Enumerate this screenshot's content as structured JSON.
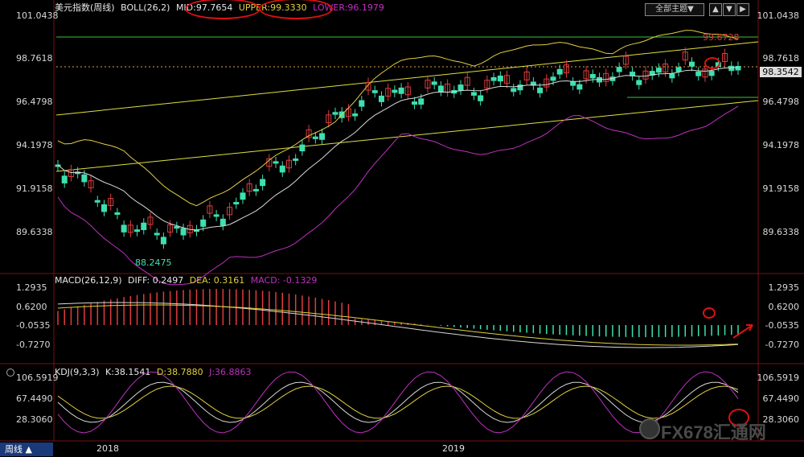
{
  "header": {
    "symbol": "美元指数(周线)",
    "boll_label": "BOLL(26,2)",
    "mid": "MID:97.7654",
    "upper": "UPPER:99.3330",
    "lower": "LOWER:96.1979"
  },
  "toolbar": {
    "dropdown_label": "全部主题▼"
  },
  "price_axis": {
    "left": [
      "101.0438",
      "98.7618",
      "96.4798",
      "94.1978",
      "91.9158",
      "89.6338"
    ],
    "right": [
      "101.0438",
      "98.7618",
      "96.4798",
      "94.1978",
      "91.9158",
      "89.6338"
    ],
    "current": "98.3542"
  },
  "price_annotations": {
    "high": "99.6728",
    "low": "88.2475"
  },
  "macd": {
    "label": "MACD(26,12,9)",
    "diff": "DIFF: 0.2497",
    "dea": "DEA: 0.3161",
    "macd": "MACD: -0.1329",
    "axis_left": [
      "1.2935",
      "0.6200",
      "-0.0535",
      "-0.7270"
    ],
    "axis_right": [
      "1.2935",
      "0.6200",
      "-0.0535",
      "-0.7270"
    ]
  },
  "kdj": {
    "label": "KDJ(9,3,3)",
    "k": "K:38.1541",
    "d": "D:38.7880",
    "j": "J:36.8863",
    "axis_left": [
      "106.5919",
      "67.4490",
      "28.3060"
    ],
    "axis_right": [
      "106.5919",
      "67.4490",
      "28.3060"
    ]
  },
  "footer": {
    "period": "周线 ▲",
    "year_2018": "2018",
    "year_2019": "2019"
  },
  "watermark": "FX678汇通网",
  "colors": {
    "up": "#e03c3c",
    "down": "#3ee0b0",
    "mid_line": "#d8d8d8",
    "upper_line": "#e0d040",
    "lower_line": "#c030c0",
    "channel": "#e0e040",
    "horizontal": "#40c040",
    "annotation": "#e01010"
  }
}
